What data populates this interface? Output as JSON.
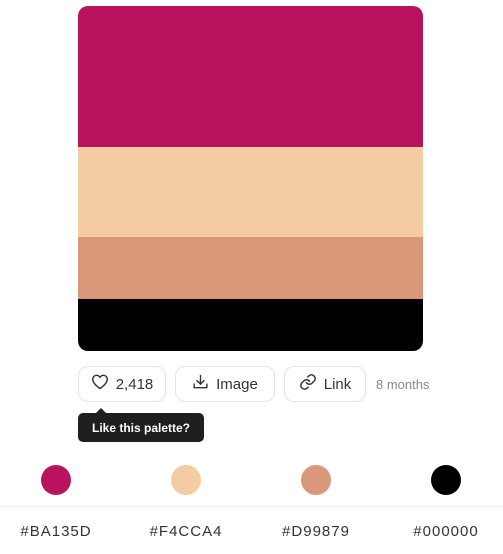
{
  "palette": {
    "colors": [
      "#BA135D",
      "#F4CCA4",
      "#D99879",
      "#000000"
    ]
  },
  "actions": {
    "like_count": "2,418",
    "image_label": "Image",
    "link_label": "Link",
    "time_ago": "8 months"
  },
  "tooltip": {
    "text": "Like this palette?"
  },
  "hex_codes": [
    "#BA135D",
    "#F4CCA4",
    "#D99879",
    "#000000"
  ],
  "icons": {
    "like": "heart-icon",
    "image": "download-icon",
    "link": "link-icon"
  }
}
